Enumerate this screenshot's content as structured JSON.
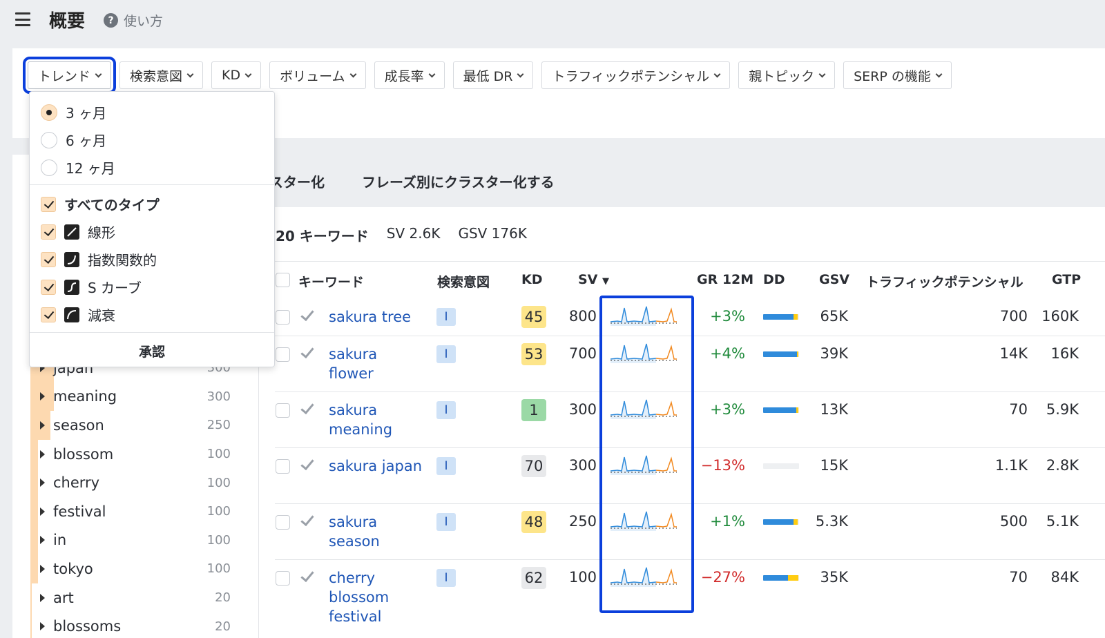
{
  "header": {
    "title": "概要",
    "help_label": "使い方"
  },
  "filters": [
    "トレンド",
    "検索意図",
    "KD",
    "ボリューム",
    "成長率",
    "最低 DR",
    "トラフィックポテンシャル",
    "親トピック",
    "SERP の機能"
  ],
  "dropdown": {
    "periods": [
      "3 ヶ月",
      "6 ヶ月",
      "12 ヶ月"
    ],
    "selected_period": "3 ヶ月",
    "all_types": "すべてのタイプ",
    "types": [
      {
        "label": "線形",
        "icon": "linear-icon"
      },
      {
        "label": "指数関数的",
        "icon": "exponential-icon"
      },
      {
        "label": "S カーブ",
        "icon": "s-curve-icon"
      },
      {
        "label": "減衰",
        "icon": "decay-icon"
      }
    ],
    "apply_label": "承認"
  },
  "tabs": {
    "tab1_partial": "スター化",
    "tab2": "フレーズ別にクラスター化する"
  },
  "summary": {
    "keywords": "20 キーワード",
    "sv": "SV 2.6K",
    "gsv": "GSV 176K"
  },
  "clusters": [
    {
      "name": "japan",
      "count": "300",
      "level": 0.95
    },
    {
      "name": "meaning",
      "count": "300",
      "level": 0.95
    },
    {
      "name": "season",
      "count": "250",
      "level": 0.8
    },
    {
      "name": "blossom",
      "count": "100",
      "level": 0.3
    },
    {
      "name": "cherry",
      "count": "100",
      "level": 0.3
    },
    {
      "name": "festival",
      "count": "100",
      "level": 0.3
    },
    {
      "name": "in",
      "count": "100",
      "level": 0.3
    },
    {
      "name": "tokyo",
      "count": "100",
      "level": 0.3
    },
    {
      "name": "art",
      "count": "20",
      "level": 0.06
    },
    {
      "name": "blossoms",
      "count": "20",
      "level": 0.06
    }
  ],
  "table": {
    "headers": {
      "keyword": "キーワード",
      "intent": "検索意図",
      "kd": "KD",
      "sv": "SV",
      "gr": "GR 12M",
      "dd": "DD",
      "gsv": "GSV",
      "tp": "トラフィックポテンシャル",
      "gtp": "GTP"
    },
    "rows": [
      {
        "keyword": [
          "sakura tree"
        ],
        "intent": "I",
        "kd": "45",
        "kd_color": "#fde58a",
        "sv": "800",
        "gr": "+3%",
        "gr_color": "#1f8a3b",
        "dd": [
          0.85,
          0.12
        ],
        "gsv": "65K",
        "tp": "700",
        "gtp": "160K"
      },
      {
        "keyword": [
          "sakura",
          "flower"
        ],
        "intent": "I",
        "kd": "53",
        "kd_color": "#fde58a",
        "sv": "700",
        "gr": "+4%",
        "gr_color": "#1f8a3b",
        "dd": [
          0.95,
          0.04
        ],
        "gsv": "39K",
        "tp": "14K",
        "gtp": "16K"
      },
      {
        "keyword": [
          "sakura",
          "meaning"
        ],
        "intent": "I",
        "kd": "1",
        "kd_color": "#9bd9a6",
        "sv": "300",
        "gr": "+3%",
        "gr_color": "#1f8a3b",
        "dd": [
          0.92,
          0.06
        ],
        "gsv": "13K",
        "tp": "70",
        "gtp": "5.9K"
      },
      {
        "keyword": [
          "sakura japan"
        ],
        "intent": "I",
        "kd": "70",
        "kd_color": "#e8e9eb",
        "sv": "300",
        "gr": "−13%",
        "gr_color": "#d12b2b",
        "dd": [
          0,
          0
        ],
        "gsv": "15K",
        "tp": "1.1K",
        "gtp": "2.8K"
      },
      {
        "keyword": [
          "sakura",
          "season"
        ],
        "intent": "I",
        "kd": "48",
        "kd_color": "#fde58a",
        "sv": "250",
        "gr": "+1%",
        "gr_color": "#1f8a3b",
        "dd": [
          0.85,
          0.12
        ],
        "gsv": "5.3K",
        "tp": "500",
        "gtp": "5.1K"
      },
      {
        "keyword": [
          "cherry",
          "blossom",
          "festival"
        ],
        "intent": "I",
        "kd": "62",
        "kd_color": "#e8e9eb",
        "sv": "100",
        "gr": "−27%",
        "gr_color": "#d12b2b",
        "dd": [
          0.7,
          0.28
        ],
        "gsv": "35K",
        "tp": "70",
        "gtp": "84K"
      }
    ]
  },
  "colors": {
    "accent": "#0b3fdc",
    "link": "#1f56b6",
    "trend_past": "#2f8bdb",
    "trend_forecast": "#f2891f"
  }
}
